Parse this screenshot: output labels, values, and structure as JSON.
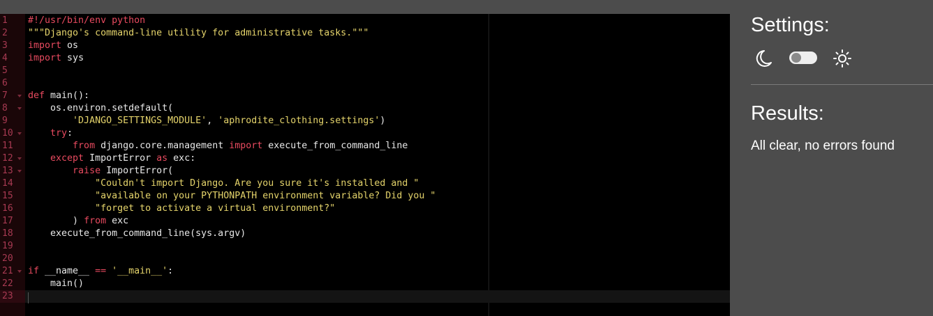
{
  "editor": {
    "lines": [
      {
        "n": "1",
        "fold": false,
        "html": [
          [
            "cm",
            "#!/usr/bin/env python"
          ]
        ]
      },
      {
        "n": "2",
        "fold": false,
        "html": [
          [
            "str",
            "\"\"\"Django's command-line utility for administrative tasks.\"\"\""
          ]
        ]
      },
      {
        "n": "3",
        "fold": false,
        "html": [
          [
            "kw",
            "import"
          ],
          [
            "",
            " os"
          ]
        ]
      },
      {
        "n": "4",
        "fold": false,
        "html": [
          [
            "kw",
            "import"
          ],
          [
            "",
            " sys"
          ]
        ]
      },
      {
        "n": "5",
        "fold": false,
        "html": []
      },
      {
        "n": "6",
        "fold": false,
        "html": []
      },
      {
        "n": "7",
        "fold": true,
        "html": [
          [
            "kw",
            "def"
          ],
          [
            "",
            " main():"
          ]
        ]
      },
      {
        "n": "8",
        "fold": true,
        "html": [
          [
            "",
            "    os.environ.setdefault("
          ]
        ]
      },
      {
        "n": "9",
        "fold": false,
        "html": [
          [
            "",
            "        "
          ],
          [
            "str",
            "'DJANGO_SETTINGS_MODULE'"
          ],
          [
            "",
            ", "
          ],
          [
            "str",
            "'aphrodite_clothing.settings'"
          ],
          [
            "",
            ")"
          ]
        ]
      },
      {
        "n": "10",
        "fold": true,
        "html": [
          [
            "",
            "    "
          ],
          [
            "kw",
            "try"
          ],
          [
            "",
            ":"
          ]
        ]
      },
      {
        "n": "11",
        "fold": false,
        "html": [
          [
            "",
            "        "
          ],
          [
            "kw",
            "from"
          ],
          [
            "",
            " django.core.management "
          ],
          [
            "kw",
            "import"
          ],
          [
            "",
            " execute_from_command_line"
          ]
        ]
      },
      {
        "n": "12",
        "fold": true,
        "html": [
          [
            "",
            "    "
          ],
          [
            "kw",
            "except"
          ],
          [
            "",
            " ImportError "
          ],
          [
            "kw",
            "as"
          ],
          [
            "",
            " exc:"
          ]
        ]
      },
      {
        "n": "13",
        "fold": true,
        "html": [
          [
            "",
            "        "
          ],
          [
            "kw",
            "raise"
          ],
          [
            "",
            " ImportError("
          ]
        ]
      },
      {
        "n": "14",
        "fold": false,
        "html": [
          [
            "",
            "            "
          ],
          [
            "str",
            "\"Couldn't import Django. Are you sure it's installed and \""
          ]
        ]
      },
      {
        "n": "15",
        "fold": false,
        "html": [
          [
            "",
            "            "
          ],
          [
            "str",
            "\"available on your PYTHONPATH environment variable? Did you \""
          ]
        ]
      },
      {
        "n": "16",
        "fold": false,
        "html": [
          [
            "",
            "            "
          ],
          [
            "str",
            "\"forget to activate a virtual environment?\""
          ]
        ]
      },
      {
        "n": "17",
        "fold": false,
        "html": [
          [
            "",
            "        ) "
          ],
          [
            "kw",
            "from"
          ],
          [
            "",
            " exc"
          ]
        ]
      },
      {
        "n": "18",
        "fold": false,
        "html": [
          [
            "",
            "    execute_from_command_line(sys.argv)"
          ]
        ]
      },
      {
        "n": "19",
        "fold": false,
        "html": []
      },
      {
        "n": "20",
        "fold": false,
        "html": []
      },
      {
        "n": "21",
        "fold": true,
        "html": [
          [
            "kw",
            "if"
          ],
          [
            "",
            " __name__ "
          ],
          [
            "kw",
            "=="
          ],
          [
            "",
            " "
          ],
          [
            "str",
            "'__main__'"
          ],
          [
            "",
            ":"
          ]
        ]
      },
      {
        "n": "22",
        "fold": false,
        "html": [
          [
            "",
            "    main()"
          ]
        ]
      },
      {
        "n": "23",
        "fold": false,
        "html": [],
        "active": true
      }
    ]
  },
  "settings": {
    "title": "Settings:",
    "dark_icon": "moon-icon",
    "light_icon": "sun-icon",
    "toggle_state": "off"
  },
  "results": {
    "title": "Results:",
    "message": "All clear, no errors found"
  },
  "colors": {
    "keyword": "#e84a5f",
    "string": "#e5d46b",
    "editor_bg": "#000000",
    "panel_bg": "#4c4c4c"
  }
}
